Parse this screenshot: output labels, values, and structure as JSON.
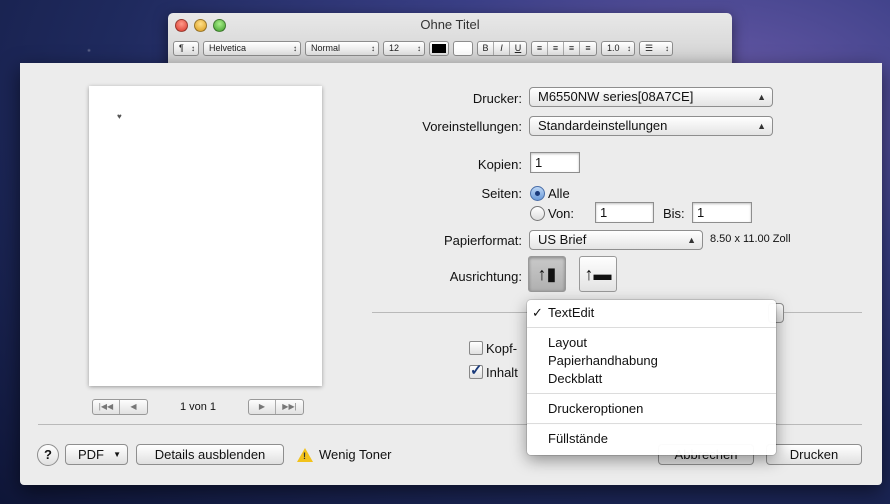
{
  "textedit": {
    "title": "Ohne Titel",
    "toolbar": {
      "paragraph": "¶",
      "font": "Helvetica",
      "style": "Normal",
      "size": "12",
      "bold": "B",
      "italic": "I",
      "underline": "U",
      "spacing": "1.0"
    }
  },
  "preview": {
    "page_indicator": "1 von 1",
    "nav_first": "|◀◀",
    "nav_prev": "◀",
    "nav_next": "▶",
    "nav_last": "▶▶|"
  },
  "form": {
    "printer_label": "Drucker:",
    "printer_value": "M6550NW series[08A7CE]",
    "presets_label": "Voreinstellungen:",
    "presets_value": "Standardeinstellungen",
    "copies_label": "Kopien:",
    "copies_value": "1",
    "pages_label": "Seiten:",
    "pages_all": "Alle",
    "pages_from": "Von:",
    "pages_from_value": "1",
    "pages_to": "Bis:",
    "pages_to_value": "1",
    "paper_label": "Papierformat:",
    "paper_value": "US Brief",
    "paper_size": "8.50 x 11.00 Zoll",
    "orientation_label": "Ausrichtung:",
    "header_checkbox": "Kopf-",
    "content_checkbox": "Inhalt"
  },
  "menu": {
    "items": [
      {
        "label": "TextEdit",
        "checked": true
      },
      {
        "label": "Layout"
      },
      {
        "label": "Papierhandhabung"
      },
      {
        "label": "Deckblatt"
      },
      {
        "label": "Druckeroptionen"
      },
      {
        "label": "Füllstände"
      }
    ]
  },
  "footer": {
    "help": "?",
    "pdf": "PDF",
    "details": "Details ausblenden",
    "warning": "Wenig Toner",
    "cancel": "Abbrechen",
    "print": "Drucken"
  }
}
